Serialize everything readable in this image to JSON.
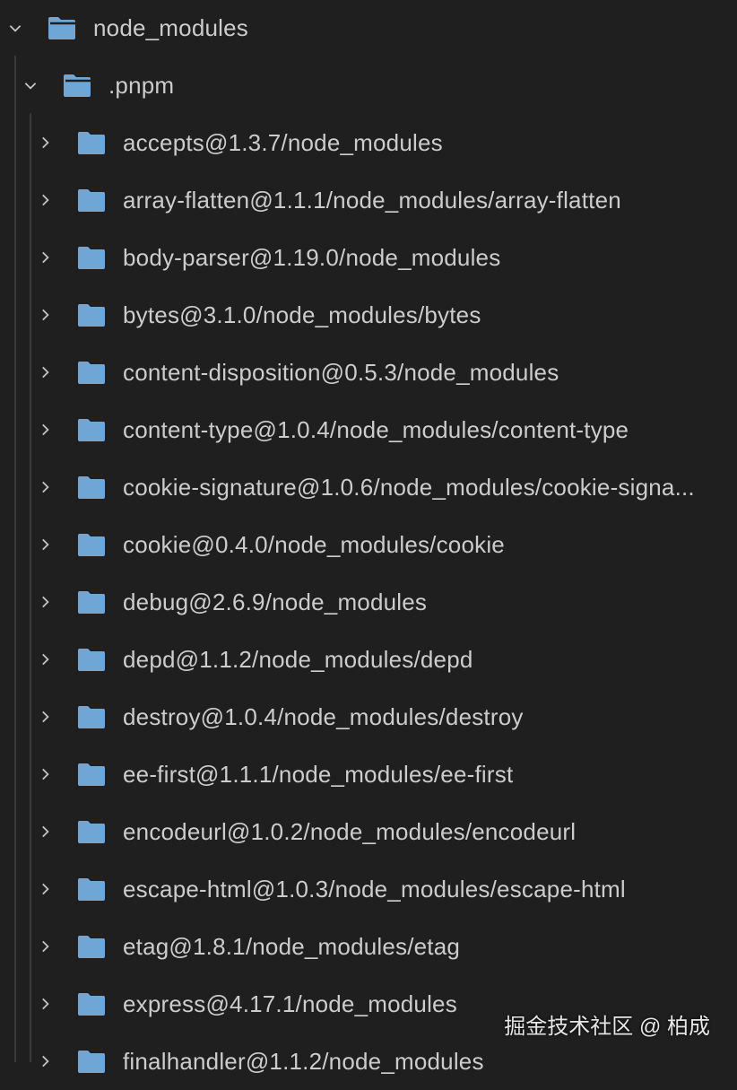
{
  "tree": {
    "root": {
      "label": "node_modules",
      "expanded": true,
      "icon": "folder-open-icon"
    },
    "pnpm": {
      "label": ".pnpm",
      "expanded": true,
      "icon": "folder-open-icon"
    },
    "items": [
      {
        "label": "accepts@1.3.7/node_modules"
      },
      {
        "label": "array-flatten@1.1.1/node_modules/array-flatten"
      },
      {
        "label": "body-parser@1.19.0/node_modules"
      },
      {
        "label": "bytes@3.1.0/node_modules/bytes"
      },
      {
        "label": "content-disposition@0.5.3/node_modules"
      },
      {
        "label": "content-type@1.0.4/node_modules/content-type"
      },
      {
        "label": "cookie-signature@1.0.6/node_modules/cookie-signa..."
      },
      {
        "label": "cookie@0.4.0/node_modules/cookie"
      },
      {
        "label": "debug@2.6.9/node_modules"
      },
      {
        "label": "depd@1.1.2/node_modules/depd"
      },
      {
        "label": "destroy@1.0.4/node_modules/destroy"
      },
      {
        "label": "ee-first@1.1.1/node_modules/ee-first"
      },
      {
        "label": "encodeurl@1.0.2/node_modules/encodeurl"
      },
      {
        "label": "escape-html@1.0.3/node_modules/escape-html"
      },
      {
        "label": "etag@1.8.1/node_modules/etag"
      },
      {
        "label": "express@4.17.1/node_modules"
      },
      {
        "label": "finalhandler@1.1.2/node_modules"
      }
    ]
  },
  "watermark": "掘金技术社区 @ 柏成",
  "colors": {
    "background": "#1f1f1f",
    "text": "#cccccc",
    "folder": "#6fa6d6"
  }
}
